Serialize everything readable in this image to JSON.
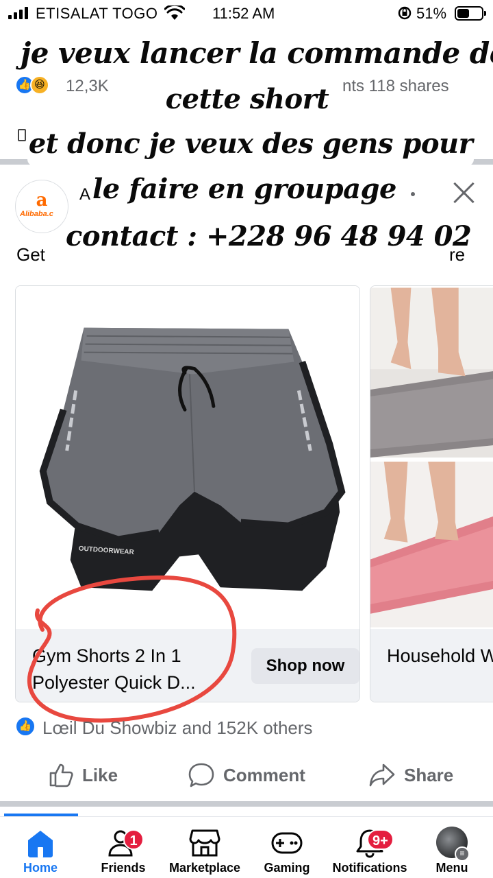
{
  "status_bar": {
    "carrier": "ETISALAT TOGO",
    "time": "11:52 AM",
    "battery": "51%",
    "battery_level": 0.51
  },
  "previous_post": {
    "reaction_count": "12,3K",
    "shares": "nts  118 shares"
  },
  "overlay_caption": {
    "line1": "je veux lancer la commande de",
    "line2": "cette short",
    "line3": "et donc je veux des gens pour",
    "line4": "le faire en groupage",
    "line5": "contact : +228 96 48 94 02"
  },
  "ad": {
    "advertiser_logo": "Alibaba.c",
    "name_fragment": "A",
    "text_left": "Get",
    "text_right": "re",
    "cards": [
      {
        "title": "Gym Shorts  2 In 1 Polyester Quick D...",
        "button": "Shop now",
        "print_text": "OUTDOORWEAR"
      },
      {
        "title": "Household W absorption"
      }
    ]
  },
  "reactions": {
    "summary": "Lœil Du Showbiz and 152K others"
  },
  "actions": {
    "like": "Like",
    "comment": "Comment",
    "share": "Share"
  },
  "bottom_nav": {
    "home": "Home",
    "friends": "Friends",
    "friends_badge": "1",
    "marketplace": "Marketplace",
    "gaming": "Gaming",
    "notifications": "Notifications",
    "notifications_badge": "9+",
    "menu": "Menu"
  },
  "colors": {
    "facebook_blue": "#1877f2",
    "badge_red": "#e41e3f",
    "secondary_text": "#65676b",
    "annotation_red": "#e8483f"
  }
}
